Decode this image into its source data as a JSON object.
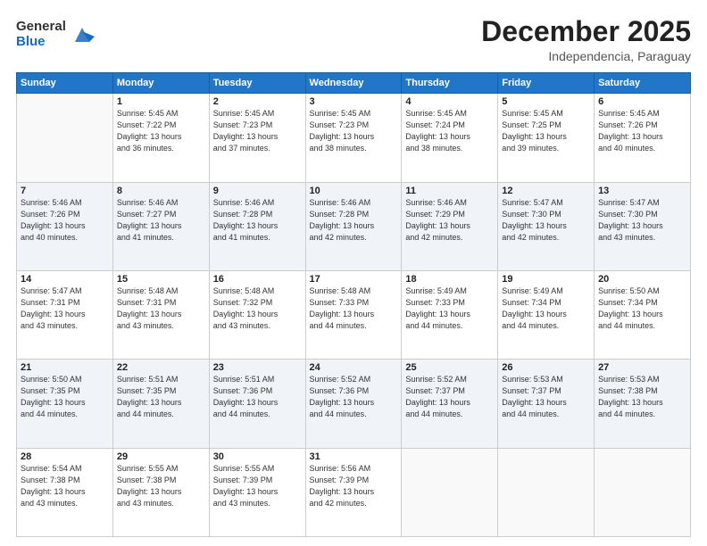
{
  "logo": {
    "general": "General",
    "blue": "Blue"
  },
  "header": {
    "title": "December 2025",
    "subtitle": "Independencia, Paraguay"
  },
  "days_of_week": [
    "Sunday",
    "Monday",
    "Tuesday",
    "Wednesday",
    "Thursday",
    "Friday",
    "Saturday"
  ],
  "weeks": [
    [
      {
        "day": "",
        "info": ""
      },
      {
        "day": "1",
        "info": "Sunrise: 5:45 AM\nSunset: 7:22 PM\nDaylight: 13 hours\nand 36 minutes."
      },
      {
        "day": "2",
        "info": "Sunrise: 5:45 AM\nSunset: 7:23 PM\nDaylight: 13 hours\nand 37 minutes."
      },
      {
        "day": "3",
        "info": "Sunrise: 5:45 AM\nSunset: 7:23 PM\nDaylight: 13 hours\nand 38 minutes."
      },
      {
        "day": "4",
        "info": "Sunrise: 5:45 AM\nSunset: 7:24 PM\nDaylight: 13 hours\nand 38 minutes."
      },
      {
        "day": "5",
        "info": "Sunrise: 5:45 AM\nSunset: 7:25 PM\nDaylight: 13 hours\nand 39 minutes."
      },
      {
        "day": "6",
        "info": "Sunrise: 5:45 AM\nSunset: 7:26 PM\nDaylight: 13 hours\nand 40 minutes."
      }
    ],
    [
      {
        "day": "7",
        "info": "Sunrise: 5:46 AM\nSunset: 7:26 PM\nDaylight: 13 hours\nand 40 minutes."
      },
      {
        "day": "8",
        "info": "Sunrise: 5:46 AM\nSunset: 7:27 PM\nDaylight: 13 hours\nand 41 minutes."
      },
      {
        "day": "9",
        "info": "Sunrise: 5:46 AM\nSunset: 7:28 PM\nDaylight: 13 hours\nand 41 minutes."
      },
      {
        "day": "10",
        "info": "Sunrise: 5:46 AM\nSunset: 7:28 PM\nDaylight: 13 hours\nand 42 minutes."
      },
      {
        "day": "11",
        "info": "Sunrise: 5:46 AM\nSunset: 7:29 PM\nDaylight: 13 hours\nand 42 minutes."
      },
      {
        "day": "12",
        "info": "Sunrise: 5:47 AM\nSunset: 7:30 PM\nDaylight: 13 hours\nand 42 minutes."
      },
      {
        "day": "13",
        "info": "Sunrise: 5:47 AM\nSunset: 7:30 PM\nDaylight: 13 hours\nand 43 minutes."
      }
    ],
    [
      {
        "day": "14",
        "info": "Sunrise: 5:47 AM\nSunset: 7:31 PM\nDaylight: 13 hours\nand 43 minutes."
      },
      {
        "day": "15",
        "info": "Sunrise: 5:48 AM\nSunset: 7:31 PM\nDaylight: 13 hours\nand 43 minutes."
      },
      {
        "day": "16",
        "info": "Sunrise: 5:48 AM\nSunset: 7:32 PM\nDaylight: 13 hours\nand 43 minutes."
      },
      {
        "day": "17",
        "info": "Sunrise: 5:48 AM\nSunset: 7:33 PM\nDaylight: 13 hours\nand 44 minutes."
      },
      {
        "day": "18",
        "info": "Sunrise: 5:49 AM\nSunset: 7:33 PM\nDaylight: 13 hours\nand 44 minutes."
      },
      {
        "day": "19",
        "info": "Sunrise: 5:49 AM\nSunset: 7:34 PM\nDaylight: 13 hours\nand 44 minutes."
      },
      {
        "day": "20",
        "info": "Sunrise: 5:50 AM\nSunset: 7:34 PM\nDaylight: 13 hours\nand 44 minutes."
      }
    ],
    [
      {
        "day": "21",
        "info": "Sunrise: 5:50 AM\nSunset: 7:35 PM\nDaylight: 13 hours\nand 44 minutes."
      },
      {
        "day": "22",
        "info": "Sunrise: 5:51 AM\nSunset: 7:35 PM\nDaylight: 13 hours\nand 44 minutes."
      },
      {
        "day": "23",
        "info": "Sunrise: 5:51 AM\nSunset: 7:36 PM\nDaylight: 13 hours\nand 44 minutes."
      },
      {
        "day": "24",
        "info": "Sunrise: 5:52 AM\nSunset: 7:36 PM\nDaylight: 13 hours\nand 44 minutes."
      },
      {
        "day": "25",
        "info": "Sunrise: 5:52 AM\nSunset: 7:37 PM\nDaylight: 13 hours\nand 44 minutes."
      },
      {
        "day": "26",
        "info": "Sunrise: 5:53 AM\nSunset: 7:37 PM\nDaylight: 13 hours\nand 44 minutes."
      },
      {
        "day": "27",
        "info": "Sunrise: 5:53 AM\nSunset: 7:38 PM\nDaylight: 13 hours\nand 44 minutes."
      }
    ],
    [
      {
        "day": "28",
        "info": "Sunrise: 5:54 AM\nSunset: 7:38 PM\nDaylight: 13 hours\nand 43 minutes."
      },
      {
        "day": "29",
        "info": "Sunrise: 5:55 AM\nSunset: 7:38 PM\nDaylight: 13 hours\nand 43 minutes."
      },
      {
        "day": "30",
        "info": "Sunrise: 5:55 AM\nSunset: 7:39 PM\nDaylight: 13 hours\nand 43 minutes."
      },
      {
        "day": "31",
        "info": "Sunrise: 5:56 AM\nSunset: 7:39 PM\nDaylight: 13 hours\nand 42 minutes."
      },
      {
        "day": "",
        "info": ""
      },
      {
        "day": "",
        "info": ""
      },
      {
        "day": "",
        "info": ""
      }
    ]
  ]
}
